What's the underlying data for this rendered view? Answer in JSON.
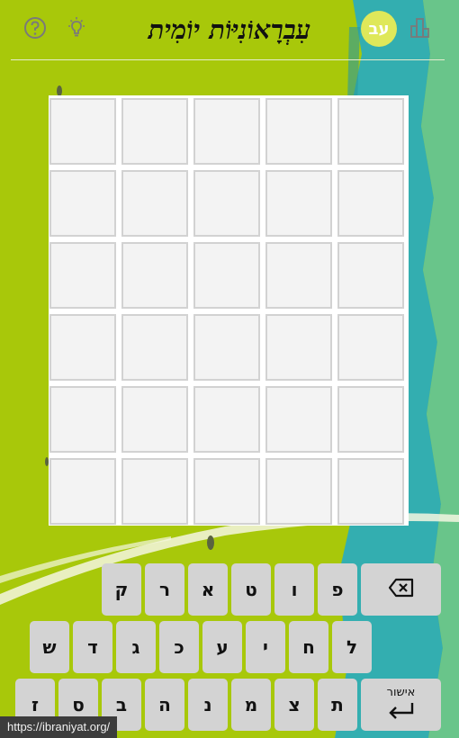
{
  "header": {
    "title": "עִבְרָאוֹנִיּוֹת יוֹמִית",
    "logo_text": "עב",
    "icons": [
      "help-icon",
      "lightbulb-icon",
      "stats-icon"
    ]
  },
  "board": {
    "rows": 6,
    "cols": 5
  },
  "keyboard": {
    "row1": [
      "פ",
      "ו",
      "ט",
      "א",
      "ר",
      "ק"
    ],
    "row2": [
      "ל",
      "ח",
      "י",
      "ע",
      "כ",
      "ג",
      "ד",
      "ש"
    ],
    "row3": [
      "ת",
      "צ",
      "מ",
      "נ",
      "ה",
      "ב",
      "ס",
      "ז"
    ],
    "enter_label": "אישור",
    "backspace_icon": "backspace-icon",
    "enter_icon": "enter-icon"
  },
  "status_url": "https://ibraniyat.org/",
  "colors": {
    "background": "#a8c80a",
    "teal": "#34b3b0",
    "tile": "#f3f3f3",
    "tile_border": "#d2d2d2",
    "key": "#d3d3d3"
  }
}
